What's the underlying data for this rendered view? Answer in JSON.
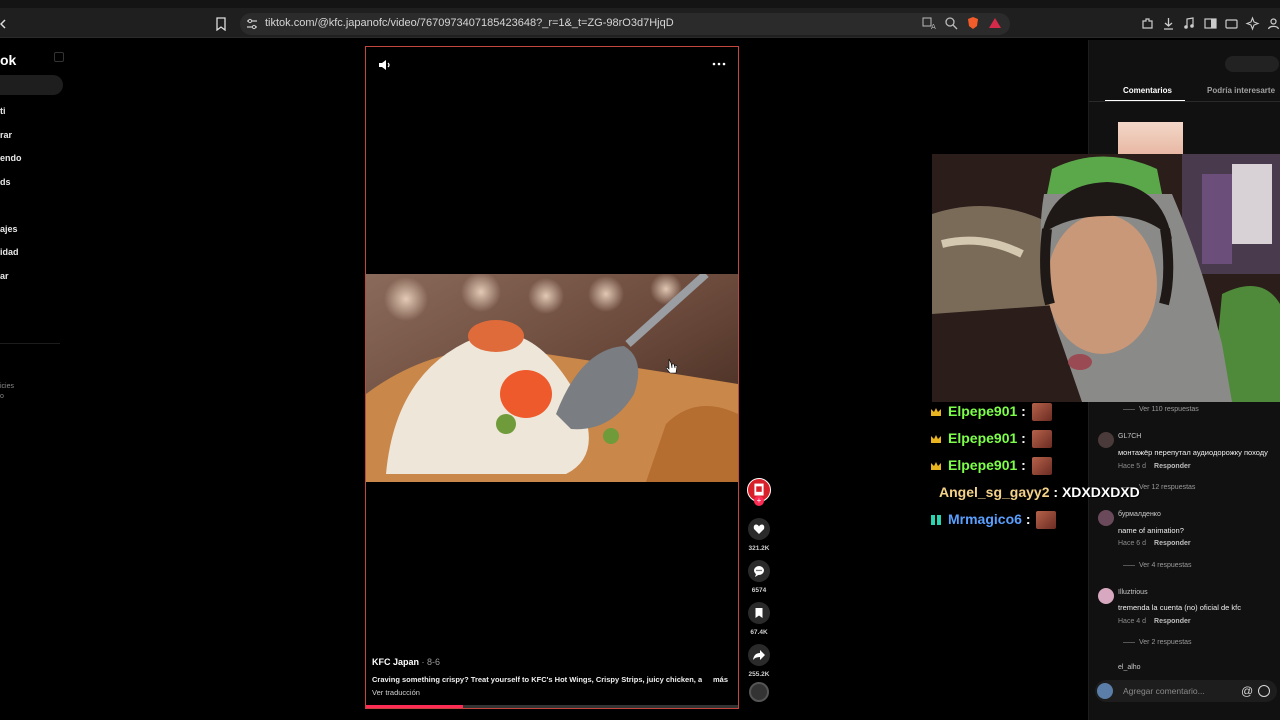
{
  "browser": {
    "url": "tiktok.com/@kfc.japanofc/video/7670973407185423648?_r=1&_t=ZG-98rO3d7HjqD"
  },
  "sidebar": {
    "logo": "ok",
    "items": [
      "ti",
      "rar",
      "endo",
      "ds",
      "ajes",
      "idad",
      "ar"
    ],
    "footer_items": [
      "icies",
      "o"
    ]
  },
  "video": {
    "author": "KFC Japan",
    "date": "· 8-6",
    "caption": "Craving something crispy? Treat yourself to KFC's Hot Wings, Crispy Strips, juicy chicken, and",
    "more_label": "más",
    "translate_label": "Ver traducción",
    "progress": 0.26
  },
  "actions": {
    "likes": "321.2K",
    "comments": "6574",
    "saves": "67.4K",
    "shares": "255.2K"
  },
  "panel": {
    "tabs": [
      "Comentarios",
      "Podría interesarte"
    ],
    "replies_top": "Ver 110 respuestas",
    "comments": [
      {
        "user": "GL7CH",
        "text": "монтажёр перепутал аудиодорожку походу",
        "meta": "Hace 5 d",
        "reply_label": "Responder",
        "replies": "Ver 12 respuestas",
        "avatar_color": "#4a3a3a"
      },
      {
        "user": "бурмалденко",
        "text": "name of animation?",
        "meta": "Hace 6 d",
        "reply_label": "Responder",
        "replies": "Ver 4 respuestas",
        "avatar_color": "#6a4a5a"
      },
      {
        "user": "Illuztrious",
        "text": "tremenda la cuenta (no) oficial de kfc",
        "meta": "Hace 4 d",
        "reply_label": "Responder",
        "replies": "Ver 2 respuestas",
        "avatar_color": "#d8a8c0"
      }
    ],
    "trailing_user": "el_alho",
    "comment_placeholder": "Agregar comentario...",
    "at_symbol": "@"
  },
  "stream_chat": [
    {
      "user": "Elpepe901",
      "sep": ":",
      "message": "",
      "color": "#7dff4a",
      "badge": "crown"
    },
    {
      "user": "Elpepe901",
      "sep": ":",
      "message": "",
      "color": "#7dff4a",
      "badge": "crown"
    },
    {
      "user": "Elpepe901",
      "sep": ":",
      "message": "",
      "color": "#7dff4a",
      "badge": "crown"
    },
    {
      "user": "Angel_sg_gayy2",
      "sep": ":",
      "message": "XDXDXDXD",
      "color": "#f5d28a",
      "badge": ""
    },
    {
      "user": "Mrmagico6",
      "sep": ":",
      "message": "",
      "color": "#5aa0ff",
      "badge": "teal"
    }
  ]
}
